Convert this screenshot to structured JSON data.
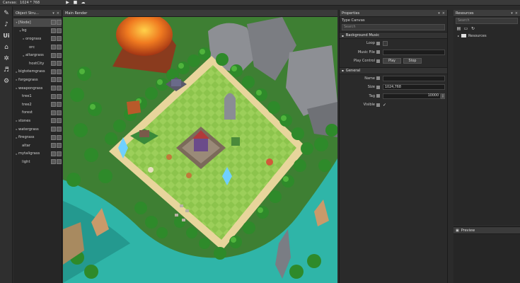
{
  "toolbar": {
    "canvas_label": "Canvas:",
    "canvas_size": "1024 * 768",
    "play_icon": "play-icon",
    "stop_icon": "stop-icon",
    "publish_icon": "cloud-upload-icon"
  },
  "tools": [
    "select-tool-icon",
    "brush-tool-icon",
    "ui-tool-icon",
    "build-tool-icon",
    "particle-tool-icon",
    "layers-tool-icon",
    "sound-tool-icon"
  ],
  "tools_ui_text": "Ui",
  "object_panel": {
    "title": "Object Stru...",
    "items": [
      {
        "name": "[Node]",
        "indent": 0,
        "arrow": "▾",
        "selected": true
      },
      {
        "name": "bg",
        "indent": 1,
        "arrow": "▾",
        "selected": false
      },
      {
        "name": "orograss",
        "indent": 2,
        "arrow": "▸",
        "selected": false
      },
      {
        "name": "orc",
        "indent": 3,
        "arrow": "",
        "selected": false
      },
      {
        "name": "altargrass",
        "indent": 2,
        "arrow": "▸",
        "selected": false
      },
      {
        "name": "hostCity",
        "indent": 3,
        "arrow": "",
        "selected": false
      },
      {
        "name": "bigtotemgrass",
        "indent": 0,
        "arrow": "▸",
        "selected": false
      },
      {
        "name": "forgegrass",
        "indent": 0,
        "arrow": "▸",
        "selected": false
      },
      {
        "name": "weapongrass",
        "indent": 0,
        "arrow": "▸",
        "selected": false
      },
      {
        "name": "tree1",
        "indent": 1,
        "arrow": "",
        "selected": false
      },
      {
        "name": "tree2",
        "indent": 1,
        "arrow": "",
        "selected": false
      },
      {
        "name": "forest",
        "indent": 1,
        "arrow": "",
        "selected": false
      },
      {
        "name": "stones",
        "indent": 0,
        "arrow": "▸",
        "selected": false
      },
      {
        "name": "watergrass",
        "indent": 0,
        "arrow": "▸",
        "selected": false
      },
      {
        "name": "firegrass",
        "indent": 0,
        "arrow": "▸",
        "selected": false
      },
      {
        "name": "altar",
        "indent": 1,
        "arrow": "",
        "selected": false
      },
      {
        "name": "mytaligrass",
        "indent": 0,
        "arrow": "▸",
        "selected": false
      },
      {
        "name": "light",
        "indent": 1,
        "arrow": "",
        "selected": false
      }
    ]
  },
  "main_render": {
    "title": "Main Render"
  },
  "properties": {
    "title": "Properties",
    "type_line": "Type Canvas",
    "search_placeholder": "Search",
    "bg_music_section": "Background Music",
    "loop_label": "Loop",
    "music_file_label": "Music File",
    "play_control_label": "Play Control",
    "play_button": "Play",
    "stop_button": "Stop",
    "general_section": "General",
    "name_label": "Name",
    "name_value": "",
    "size_label": "Size",
    "size_value": "1024,768",
    "tag_label": "Tag",
    "tag_value": "10000",
    "visible_label": "Visible",
    "visible_check": "✓"
  },
  "resources": {
    "title": "Resources",
    "search_placeholder": "Search",
    "root_folder": "Resources"
  },
  "preview": {
    "title": "Preview"
  },
  "colors": {
    "grass_light": "#9ccf5a",
    "grass_dark": "#86bf46",
    "water": "#2fb5a8",
    "forest": "#2e8a2a",
    "rock": "#8d8f94",
    "lava": "#e07a22"
  }
}
